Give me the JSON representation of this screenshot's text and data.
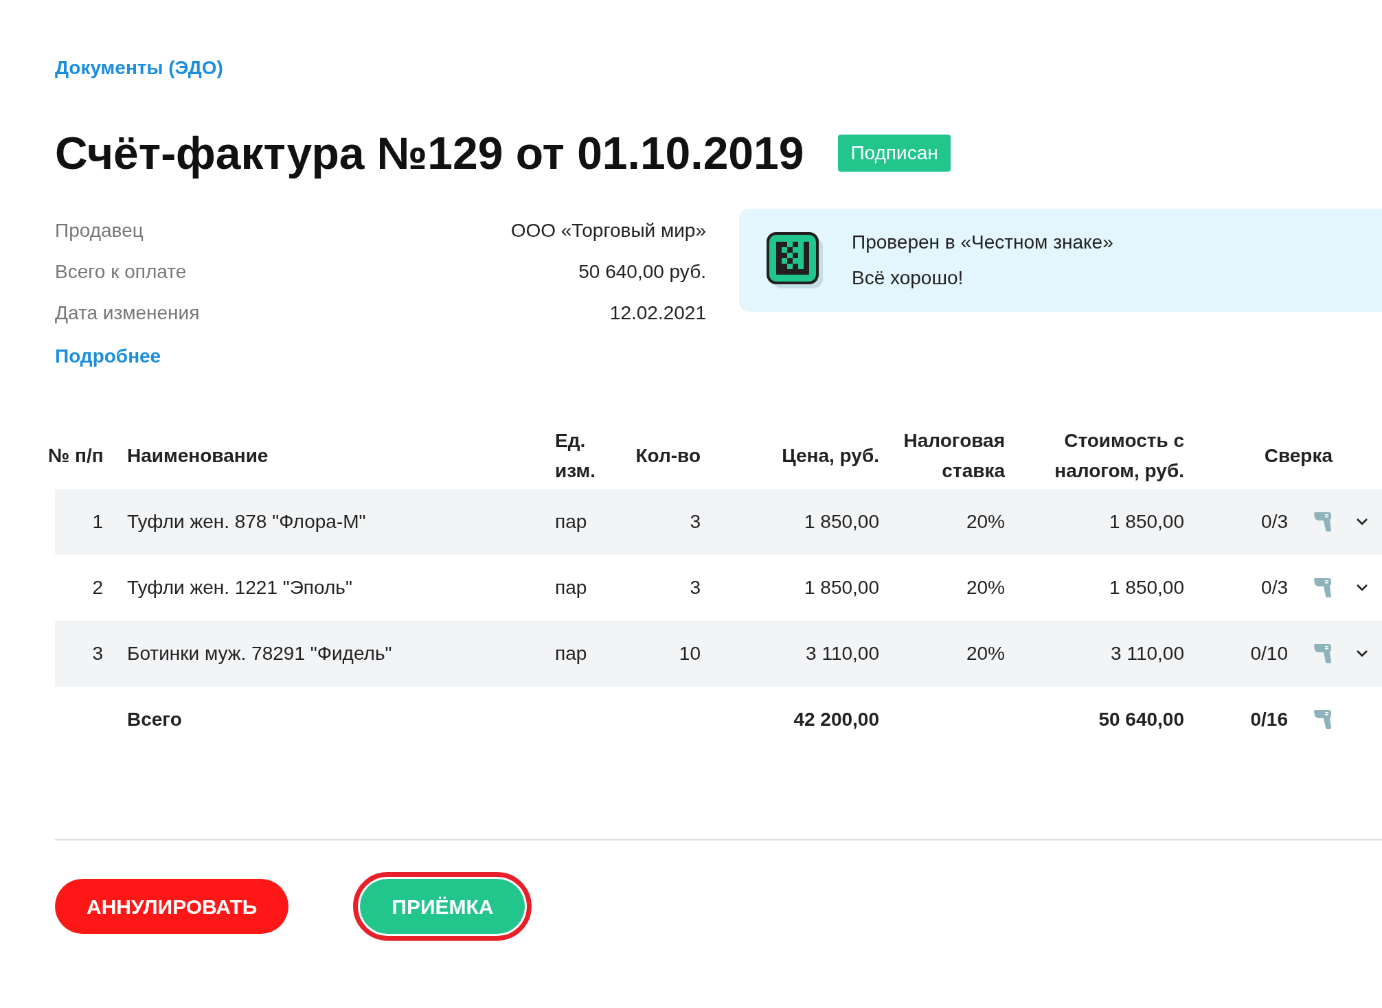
{
  "breadcrumb": "Документы (ЭДО)",
  "title": "Счёт-фактура №129 от 01.10.2019",
  "status_badge": "Подписан",
  "details": [
    {
      "label": "Продавец",
      "value": "ООО «Торговый мир»"
    },
    {
      "label": "Всего к оплате",
      "value": "50 640,00 руб."
    },
    {
      "label": "Дата изменения",
      "value": "12.02.2021"
    }
  ],
  "details_link": "Подробнее",
  "check_panel": {
    "lines": [
      "Проверен в «Честном знаке»",
      "Всё хорошо!"
    ]
  },
  "table": {
    "columns": [
      "№ п/п",
      "Наименование",
      "Ед. изм.",
      "Кол-во",
      "Цена, руб.",
      "Налоговая ставка",
      "Стоимость с налогом, руб.",
      "Сверка"
    ],
    "rows": [
      {
        "number": "1",
        "name": "Туфли жен. 878 \"Флора-М\"",
        "unit": "пар",
        "qty": "3",
        "price": "1 850,00",
        "tax": "20%",
        "cost": "1 850,00",
        "check": "0/3",
        "expanded": false
      },
      {
        "number": "2",
        "name": "Туфли жен. 1221 \"Эполь\"",
        "unit": "пар",
        "qty": "3",
        "price": "1 850,00",
        "tax": "20%",
        "cost": "1 850,00",
        "check": "0/3",
        "expanded": false
      },
      {
        "number": "3",
        "name": "Ботинки муж. 78291 \"Фидель\"",
        "unit": "пар",
        "qty": "10",
        "price": "3 110,00",
        "tax": "20%",
        "cost": "3 110,00",
        "check": "0/10",
        "expanded": false
      }
    ],
    "total": {
      "label": "Всего",
      "price": "42 200,00",
      "cost": "50 640,00",
      "check": "0/16"
    }
  },
  "buttons": [
    {
      "label": "АННУЛИРОВАТЬ",
      "kind": "danger",
      "highlighted": false
    },
    {
      "label": "ПРИЁМКА",
      "kind": "primary",
      "highlighted": true
    }
  ]
}
